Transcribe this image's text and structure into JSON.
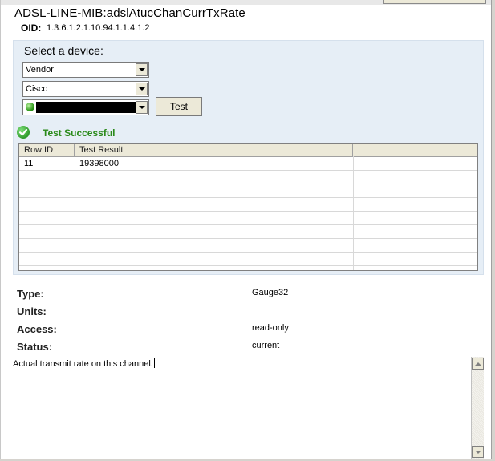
{
  "header": {
    "title": "ADSL-LINE-MIB:adslAtucChanCurrTxRate",
    "oid_label": "OID:",
    "oid_value": "1.3.6.1.2.1.10.94.1.1.4.1.2"
  },
  "device_selector": {
    "label": "Select a device:",
    "vendor_filter": "Vendor",
    "vendor_value": "Cisco",
    "device_value": "",
    "test_button": "Test"
  },
  "test_status": {
    "text": "Test Successful",
    "icon": "check-circle-icon",
    "color": "#2a8a1a"
  },
  "results_table": {
    "columns": [
      "Row ID",
      "Test Result",
      ""
    ],
    "rows": [
      [
        "11",
        "19398000",
        ""
      ]
    ]
  },
  "properties": {
    "type_label": "Type:",
    "type_value": "Gauge32",
    "units_label": "Units:",
    "units_value": "",
    "access_label": "Access:",
    "access_value": "read-only",
    "status_label": "Status:",
    "status_value": "current"
  },
  "description": {
    "text": "Actual transmit rate on this channel."
  }
}
